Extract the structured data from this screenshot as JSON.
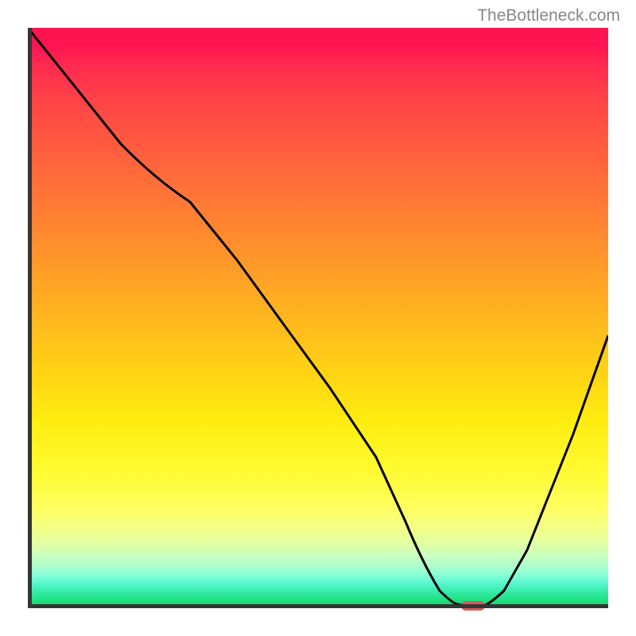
{
  "watermark": "TheBottleneck.com",
  "chart_data": {
    "type": "line",
    "title": "",
    "xlabel": "",
    "ylabel": "",
    "xlim": [
      0,
      100
    ],
    "ylim": [
      0,
      100
    ],
    "grid": false,
    "curve": {
      "x": [
        0,
        16,
        22,
        28,
        36,
        44,
        52,
        60,
        65,
        68,
        71,
        73,
        76,
        78,
        82,
        86,
        90,
        94,
        100
      ],
      "y": [
        100,
        80,
        74,
        70,
        60,
        49,
        38,
        26,
        15,
        8,
        3,
        1,
        0,
        0,
        3,
        10,
        20,
        30,
        47
      ]
    },
    "marker": {
      "x": 77,
      "y": 0,
      "width": 4,
      "shape": "rounded"
    },
    "gradient_stops": [
      {
        "pos": 0,
        "color": "#ff1452"
      },
      {
        "pos": 50,
        "color": "#ffc020"
      },
      {
        "pos": 80,
        "color": "#ffff60"
      },
      {
        "pos": 100,
        "color": "#18d468"
      }
    ]
  }
}
